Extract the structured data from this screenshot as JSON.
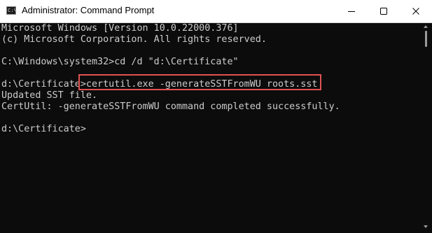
{
  "window": {
    "title": "Administrator: Command Prompt",
    "app_icon_text": "C:\\",
    "icons": {
      "app": "command-prompt-icon",
      "minimize": "minimize-icon",
      "maximize": "maximize-icon",
      "close": "close-icon"
    }
  },
  "console": {
    "lines": [
      "Microsoft Windows [Version 10.0.22000.376]",
      "(c) Microsoft Corporation. All rights reserved.",
      "",
      "C:\\Windows\\system32>cd /d \"d:\\Certificate\"",
      "",
      "d:\\Certificate>certutil.exe -generateSSTFromWU roots.sst",
      "Updated SST file.",
      "CertUtil: -generateSSTFromWU command completed successfully.",
      "",
      "d:\\Certificate>"
    ],
    "highlighted_command": "certutil.exe -generateSSTFromWU roots.sst"
  },
  "colors": {
    "console_background": "#0c0c0c",
    "console_text": "#cccccc",
    "highlight_border": "#e05252",
    "titlebar_background": "#ffffff"
  }
}
